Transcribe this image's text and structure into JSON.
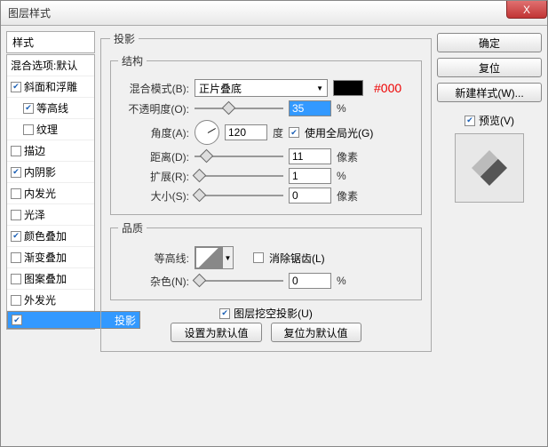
{
  "window": {
    "title": "图层样式"
  },
  "close": "X",
  "sidebar": {
    "header": "样式",
    "blend": "混合选项:默认",
    "items": [
      {
        "label": "斜面和浮雕",
        "checked": true,
        "indent": false
      },
      {
        "label": "等高线",
        "checked": true,
        "indent": true
      },
      {
        "label": "纹理",
        "checked": false,
        "indent": true
      },
      {
        "label": "描边",
        "checked": false,
        "indent": false
      },
      {
        "label": "内阴影",
        "checked": true,
        "indent": false
      },
      {
        "label": "内发光",
        "checked": false,
        "indent": false
      },
      {
        "label": "光泽",
        "checked": false,
        "indent": false
      },
      {
        "label": "颜色叠加",
        "checked": true,
        "indent": false
      },
      {
        "label": "渐变叠加",
        "checked": false,
        "indent": false
      },
      {
        "label": "图案叠加",
        "checked": false,
        "indent": false
      },
      {
        "label": "外发光",
        "checked": false,
        "indent": false
      },
      {
        "label": "投影",
        "checked": true,
        "indent": false,
        "selected": true
      }
    ]
  },
  "panel": {
    "title": "投影",
    "structure": {
      "title": "结构",
      "blend_label": "混合模式(B):",
      "blend_value": "正片叠底",
      "hex": "#000",
      "opacity_label": "不透明度(O):",
      "opacity_value": "35",
      "opacity_unit": "%",
      "angle_label": "角度(A):",
      "angle_value": "120",
      "angle_unit": "度",
      "global_label": "使用全局光(G)",
      "global_checked": true,
      "distance_label": "距离(D):",
      "distance_value": "11",
      "distance_unit": "像素",
      "spread_label": "扩展(R):",
      "spread_value": "1",
      "spread_unit": "%",
      "size_label": "大小(S):",
      "size_value": "0",
      "size_unit": "像素"
    },
    "quality": {
      "title": "品质",
      "contour_label": "等高线:",
      "antialias_label": "消除锯齿(L)",
      "antialias_checked": false,
      "noise_label": "杂色(N):",
      "noise_value": "0",
      "noise_unit": "%"
    },
    "knockout_label": "图层挖空投影(U)",
    "knockout_checked": true,
    "default_btn": "设置为默认值",
    "reset_btn": "复位为默认值"
  },
  "right": {
    "ok": "确定",
    "cancel": "复位",
    "newstyle": "新建样式(W)...",
    "preview_label": "预览(V)",
    "preview_checked": true
  }
}
